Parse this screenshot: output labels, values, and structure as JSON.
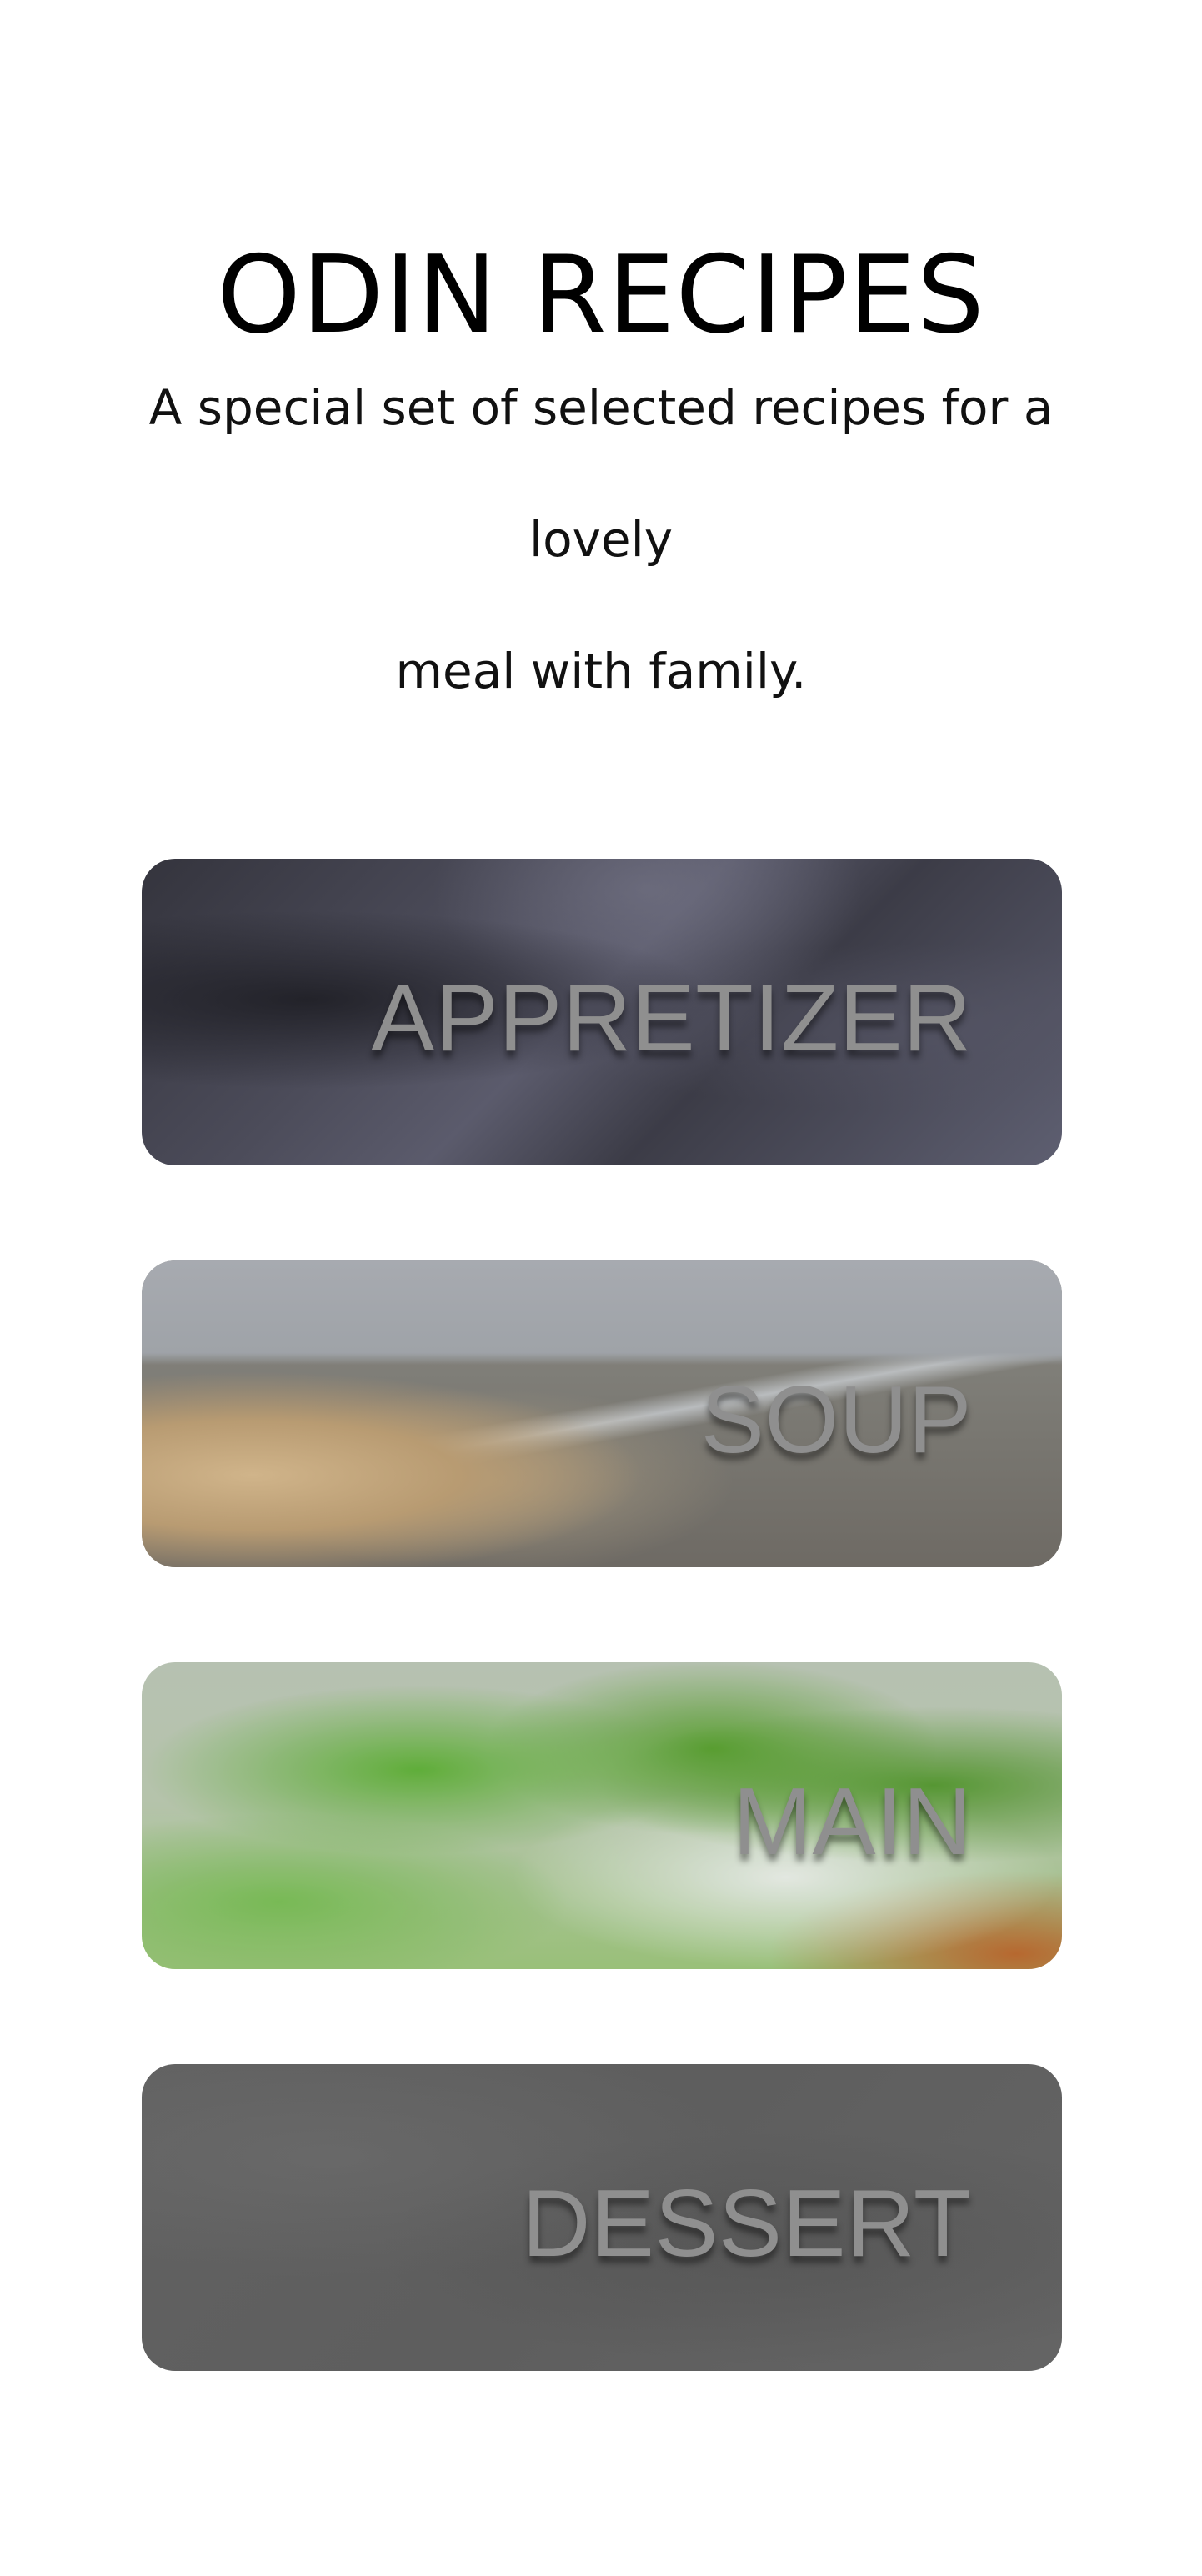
{
  "header": {
    "title": "ODIN RECIPES",
    "subtitle_line1": "A special set of selected recipes for a lovely",
    "subtitle_line2": "meal with family."
  },
  "categories": [
    {
      "label": "APPRETIZER"
    },
    {
      "label": "SOUP"
    },
    {
      "label": "MAIN"
    },
    {
      "label": "DESSERT"
    }
  ]
}
